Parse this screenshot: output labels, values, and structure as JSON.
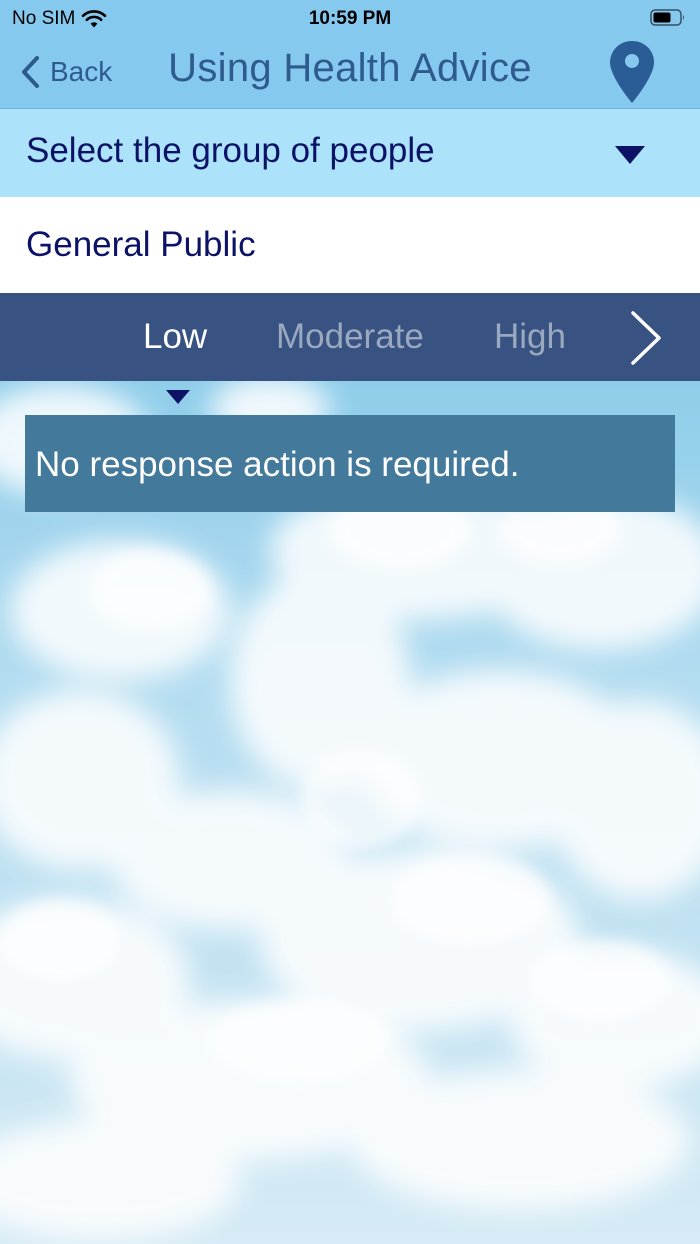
{
  "status_bar": {
    "carrier": "No SIM",
    "time": "10:59 PM"
  },
  "nav": {
    "back_label": "Back",
    "title": "Using Health Advice",
    "location_icon": "map-pin-icon"
  },
  "group_selector": {
    "label": "Select the group of people",
    "selected_value": "General Public"
  },
  "risk_tabs": {
    "items": [
      {
        "label": "Low",
        "active": true
      },
      {
        "label": "Moderate",
        "active": false
      },
      {
        "label": "High",
        "active": false
      }
    ],
    "next_icon": "chevron-right-icon"
  },
  "advice": {
    "text": "No response action is required."
  },
  "colors": {
    "nav_bar": "#86c9ef",
    "nav_text": "#2e5a8c",
    "selector_bg": "#ade3fa",
    "selector_text": "#0c1366",
    "tabs_bg": "#385282",
    "tab_active": "#ffffff",
    "tab_inactive": "#9aa8c0",
    "advice_bg": "#43799b"
  }
}
